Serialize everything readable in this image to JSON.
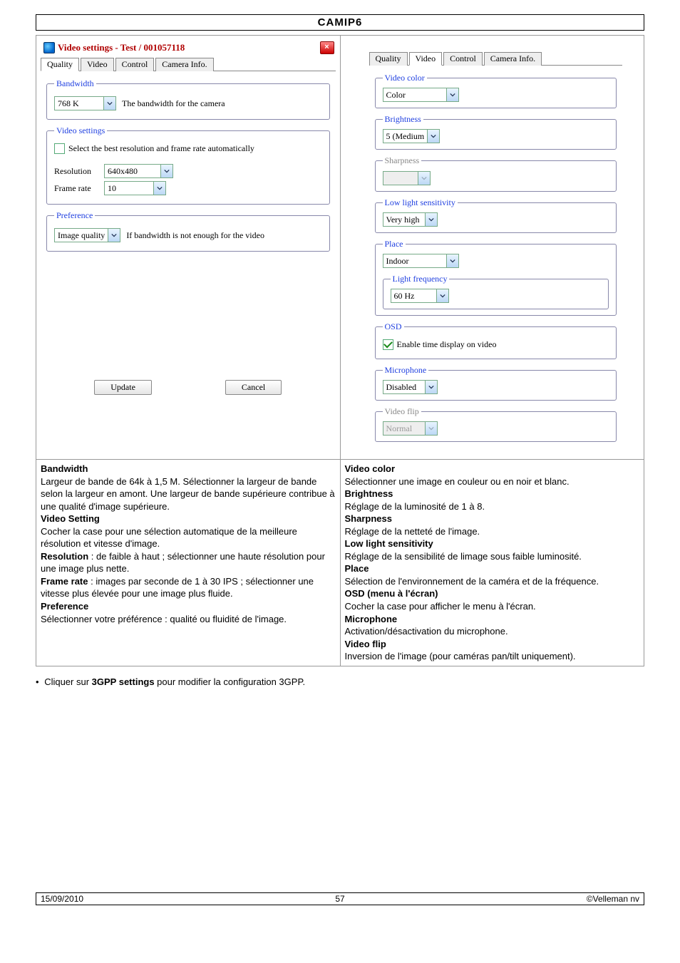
{
  "doc_title": "CAMIP6",
  "dialog": {
    "title": "Video settings - Test / 001057118",
    "close": "×",
    "tabs": [
      "Quality",
      "Video",
      "Control",
      "Camera Info."
    ],
    "active_tab_left": 0,
    "active_tab_right": 1,
    "bandwidth": {
      "legend": "Bandwidth",
      "value": "768 K",
      "hint": "The bandwidth for the camera"
    },
    "video_settings": {
      "legend": "Video settings",
      "auto_label": "Select the best resolution and frame rate automatically",
      "resolution_label": "Resolution",
      "resolution_value": "640x480",
      "framerate_label": "Frame rate",
      "framerate_value": "10"
    },
    "preference": {
      "legend": "Preference",
      "value": "Image quality",
      "hint": "If bandwidth is not enough for the video"
    },
    "buttons": {
      "update": "Update",
      "cancel": "Cancel"
    },
    "video_color": {
      "legend": "Video color",
      "value": "Color"
    },
    "brightness": {
      "legend": "Brightness",
      "value": "5 (Medium"
    },
    "sharpness": {
      "legend": "Sharpness",
      "value": ""
    },
    "lowlight": {
      "legend": "Low light sensitivity",
      "value": "Very high"
    },
    "place": {
      "legend": "Place",
      "value": "Indoor"
    },
    "lightfreq": {
      "legend": "Light frequency",
      "value": "60 Hz"
    },
    "osd": {
      "legend": "OSD",
      "label": "Enable time display on video"
    },
    "microphone": {
      "legend": "Microphone",
      "value": "Disabled"
    },
    "videoflip": {
      "legend": "Video flip",
      "value": "Normal"
    }
  },
  "desc_left": {
    "h1": "Bandwidth",
    "p1": "Largeur de bande de 64k à 1,5 M. Sélectionner la largeur de bande selon la largeur en amont. Une largeur de bande supérieure contribue à une qualité d'image supérieure.",
    "h2": "Video Setting",
    "p2": "Cocher la case pour une sélection automatique de la meilleure résolution et vitesse d'image.",
    "h3": "Resolution",
    "p3": " : de faible à haut ; sélectionner une haute résolution pour une image plus nette.",
    "h4": "Frame rate",
    "p4": " : images par seconde de 1 à 30 IPS ; sélectionner une vitesse plus élevée pour une image plus fluide.",
    "h5": "Preference",
    "p5": "Sélectionner votre préférence : qualité ou fluidité de l'image."
  },
  "desc_right": {
    "h1": "Video color",
    "p1": "Sélectionner une image en couleur ou en noir et blanc.",
    "h2": "Brightness",
    "p2": "Réglage de la luminosité de 1 à 8.",
    "h3": "Sharpness",
    "p3": "Réglage de la netteté de l'image.",
    "h4": "Low light sensitivity",
    "p4": "Réglage de la sensibilité de limage sous faible luminosité.",
    "h5": "Place",
    "p5": "Sélection de l'environnement de la caméra et de la fréquence.",
    "h6": "OSD (menu à l'écran)",
    "p6": "Cocher la case pour afficher le menu à l'écran.",
    "h7": "Microphone",
    "p7": "Activation/désactivation du microphone.",
    "h8": "Video flip",
    "p8": "Inversion de l'image (pour caméras pan/tilt uniquement)."
  },
  "after": {
    "text_pre": "Cliquer sur ",
    "text_bold": "3GPP settings",
    "text_post": " pour modifier la configuration 3GPP."
  },
  "footer": {
    "left": "15/09/2010",
    "center": "57",
    "right": "©Velleman nv"
  }
}
